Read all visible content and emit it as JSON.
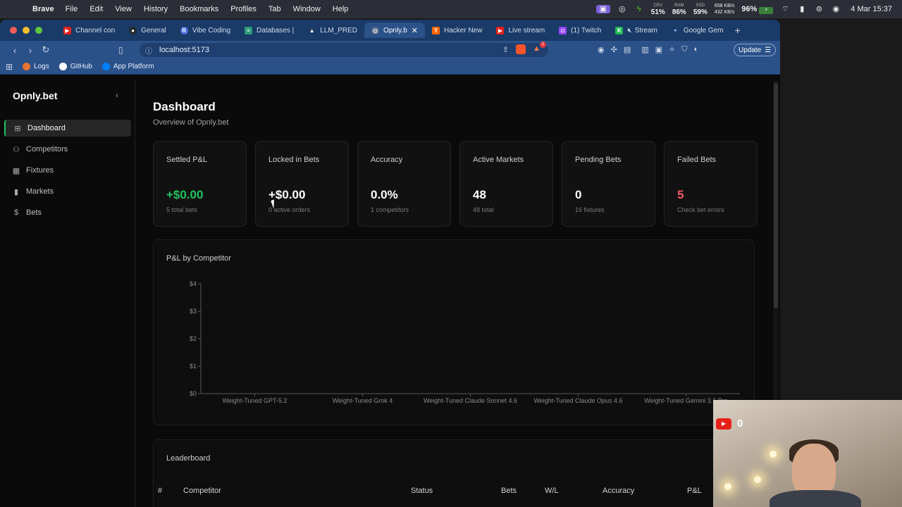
{
  "menubar": {
    "app": "Brave",
    "menus": [
      "File",
      "Edit",
      "View",
      "History",
      "Bookmarks",
      "Profiles",
      "Tab",
      "Window",
      "Help"
    ],
    "cpu_label": "CPU",
    "cpu": "51%",
    "ram_label": "RAM",
    "ram": "86%",
    "ssd_label": "SSD",
    "ssd": "59%",
    "net_up": "658 KB/s",
    "net_down": "432 KB/s",
    "battery": "96%",
    "clock": "4 Mar  15:37"
  },
  "tabs": [
    {
      "label": "Channel con",
      "color": "#e62117"
    },
    {
      "label": "General",
      "color": "#24292f"
    },
    {
      "label": "Vibe Coding",
      "color": "#4b6bd6"
    },
    {
      "label": "Databases |",
      "color": "#2b9a7b"
    },
    {
      "label": "LLM_PRED",
      "color": "#333"
    },
    {
      "label": "Opnly.b",
      "color": "#666",
      "active": true
    },
    {
      "label": "Hacker New",
      "color": "#ff6600"
    },
    {
      "label": "Live stream",
      "color": "#e62117"
    },
    {
      "label": "(1) Twitch",
      "color": "#9146ff"
    },
    {
      "label": "Stream",
      "color": "#1db954"
    },
    {
      "label": "Google Gem",
      "color": "#4285f4"
    }
  ],
  "url": "localhost:5173",
  "update_label": "Update",
  "bookmarks": [
    "Logs",
    "GitHub",
    "App Platform"
  ],
  "app": {
    "brand": "Opnly.bet",
    "nav": [
      "Dashboard",
      "Competitors",
      "Fixtures",
      "Markets",
      "Bets"
    ],
    "title": "Dashboard",
    "subtitle": "Overview of Opnly.bet",
    "cards": [
      {
        "label": "Settled P&L",
        "value": "+$0.00",
        "sub": "5 total bets"
      },
      {
        "label": "Locked in Bets",
        "value": "+$0.00",
        "sub": "0 active orders"
      },
      {
        "label": "Accuracy",
        "value": "0.0%",
        "sub": "1 competitors"
      },
      {
        "label": "Active Markets",
        "value": "48",
        "sub": "48 total"
      },
      {
        "label": "Pending Bets",
        "value": "0",
        "sub": "16 fixtures"
      },
      {
        "label": "Failed Bets",
        "value": "5",
        "sub": "Check bet errors"
      }
    ],
    "leaderboard": {
      "title": "Leaderboard",
      "columns": [
        "#",
        "Competitor",
        "Status",
        "Bets",
        "W/L",
        "Accuracy",
        "P&L"
      ]
    }
  },
  "webcam": {
    "yt_count": "0"
  },
  "chart_data": {
    "type": "bar",
    "title": "P&L by Competitor",
    "categories": [
      "Weight-Tuned GPT-5.2",
      "Weight-Tuned Grok 4",
      "Weight-Tuned Claude Sonnet 4.6",
      "Weight-Tuned Claude Opus 4.6",
      "Weight-Tuned Gemini 3.1 Pro"
    ],
    "values": [
      0,
      0,
      0,
      0,
      0
    ],
    "yticks": [
      "$0",
      "$1",
      "$2",
      "$3",
      "$4"
    ],
    "ylim": [
      0,
      4
    ],
    "xlabel": "",
    "ylabel": "",
    "grid": false
  }
}
